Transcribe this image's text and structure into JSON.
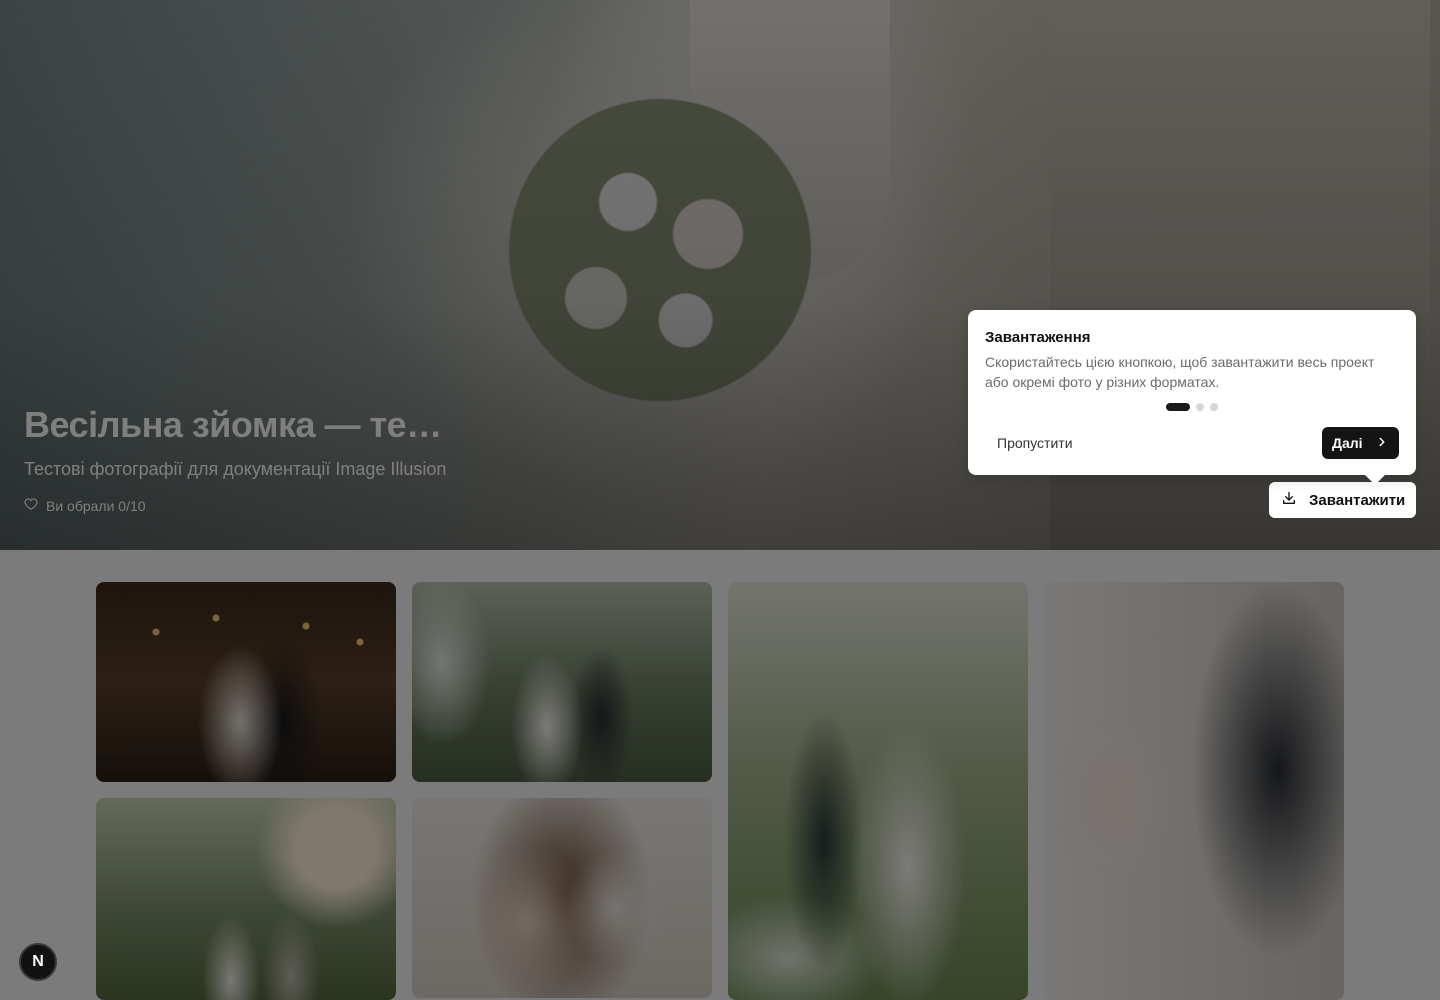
{
  "hero": {
    "title": "Весільна зйомка — те…",
    "subtitle": "Тестові фотографії для документації Image Illusion",
    "likes_text": "Ви обрали 0/10",
    "like_icon": "heart-icon"
  },
  "download_button": {
    "label": "Завантажити",
    "icon": "download-icon"
  },
  "tour": {
    "title": "Завантаження",
    "text": "Скористайтесь цією кнопкою, щоб завантажити весь проект або окремі фото у різних форматах.",
    "step": 1,
    "total_steps": 3,
    "skip_label": "Пропустити",
    "next_label": "Далі",
    "next_icon": "chevron-right-icon"
  },
  "gallery": {
    "photos": [
      {
        "name": "photo-first-dance"
      },
      {
        "name": "photo-ceremony-arch"
      },
      {
        "name": "photo-couple-veil"
      },
      {
        "name": "photo-holding-hands"
      },
      {
        "name": "photo-garden-couple"
      },
      {
        "name": "photo-bride-mirror"
      }
    ]
  },
  "floating_badge": {
    "label": "N"
  },
  "colors": {
    "overlay": "#000000",
    "button_dark": "#141414",
    "popover_bg": "#ffffff"
  }
}
